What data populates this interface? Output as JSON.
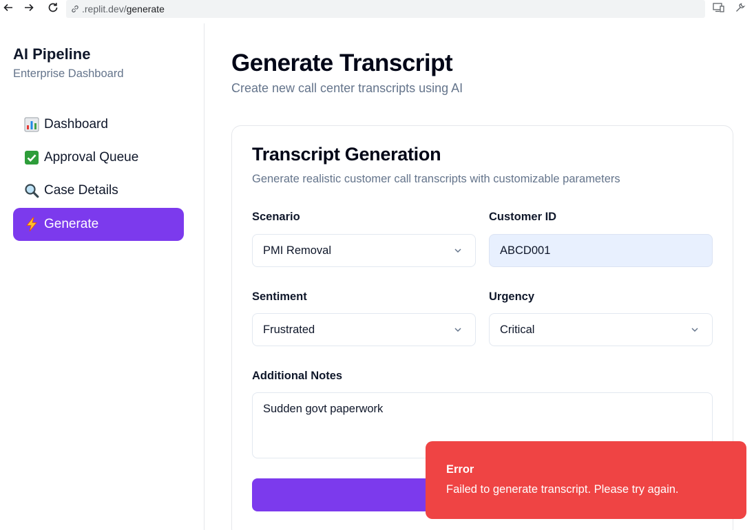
{
  "browser": {
    "url_prefix": ".replit.dev/",
    "url_path": "generate",
    "back_icon": "arrow-left-icon",
    "forward_icon": "arrow-right-icon",
    "reload_icon": "reload-icon"
  },
  "sidebar": {
    "brand_title": "AI Pipeline",
    "brand_subtitle": "Enterprise Dashboard",
    "items": [
      {
        "label": "Dashboard",
        "icon": "bar-chart-icon",
        "active": false
      },
      {
        "label": "Approval Queue",
        "icon": "check-mark-icon",
        "active": false
      },
      {
        "label": "Case Details",
        "icon": "magnifier-icon",
        "active": false
      },
      {
        "label": "Generate",
        "icon": "lightning-icon",
        "active": true
      }
    ],
    "accent": "#7c3aed"
  },
  "main": {
    "title": "Generate Transcript",
    "subtitle": "Create new call center transcripts using AI",
    "card": {
      "title": "Transcript Generation",
      "subtitle": "Generate realistic customer call transcripts with customizable parameters",
      "scenario": {
        "label": "Scenario",
        "value": "PMI Removal"
      },
      "customer_id": {
        "label": "Customer ID",
        "value": "ABCD001"
      },
      "sentiment": {
        "label": "Sentiment",
        "value": "Frustrated"
      },
      "urgency": {
        "label": "Urgency",
        "value": "Critical"
      },
      "notes": {
        "label": "Additional Notes",
        "value": "Sudden govt paperwork"
      }
    }
  },
  "toast": {
    "title": "Error",
    "message": "Failed to generate transcript. Please try again.",
    "color": "#ef4444"
  }
}
